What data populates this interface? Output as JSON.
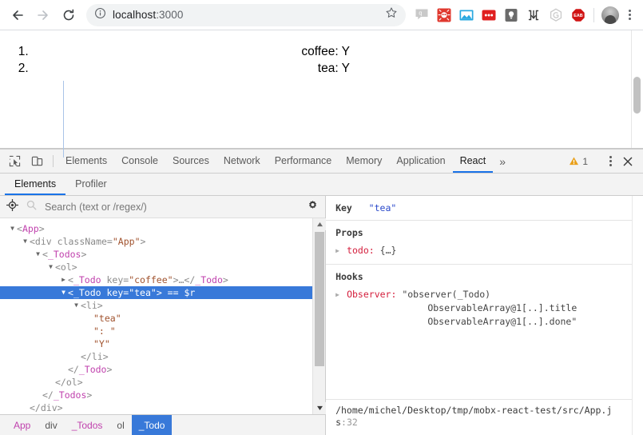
{
  "browser": {
    "back_label": "Back",
    "forward_label": "Forward",
    "reload_label": "Reload",
    "url_host": "localhost",
    "url_port": ":3000",
    "bookmark_label": "Bookmark this page",
    "menu_label": "Customize and control Chrome",
    "extensions": [
      {
        "name": "speech-bubble-extension-icon",
        "color": "#bfbfbf",
        "glyph": "q"
      },
      {
        "name": "red-spider-extension-icon",
        "color": "#e0392f",
        "glyph": ""
      },
      {
        "name": "blue-window-extension-icon",
        "color": "#2196f3",
        "glyph": ""
      },
      {
        "name": "red-dots-extension-icon",
        "color": "#e02020",
        "glyph": "•••"
      },
      {
        "name": "dark-bulb-extension-icon",
        "color": "#5a5a5a",
        "glyph": ""
      },
      {
        "name": "bracket-extension-icon",
        "color": "#ffffff",
        "glyph": "]v["
      },
      {
        "name": "gray-hex-extension-icon",
        "color": "#d8d8d8",
        "glyph": ""
      },
      {
        "name": "ead-stop-extension-icon",
        "color": "#d01414",
        "glyph": "EAB"
      }
    ]
  },
  "page": {
    "todos": [
      {
        "title": "coffee",
        "separator": ": ",
        "done": "Y",
        "text": "coffee: Y"
      },
      {
        "title": "tea",
        "separator": ": ",
        "done": "Y",
        "text": "tea: Y"
      }
    ]
  },
  "devtools": {
    "inspect_label": "Inspect element",
    "device_label": "Toggle device toolbar",
    "tabs": [
      {
        "label": "Elements",
        "active": false
      },
      {
        "label": "Console",
        "active": false
      },
      {
        "label": "Sources",
        "active": false
      },
      {
        "label": "Network",
        "active": false
      },
      {
        "label": "Performance",
        "active": false
      },
      {
        "label": "Memory",
        "active": false
      },
      {
        "label": "Application",
        "active": false
      },
      {
        "label": "React",
        "active": true
      }
    ],
    "more_tabs_glyph": "»",
    "warning_count": "1",
    "kebab_label": "More options",
    "close_label": "Close DevTools"
  },
  "react": {
    "subtabs": [
      {
        "label": "Elements",
        "active": true
      },
      {
        "label": "Profiler",
        "active": false
      }
    ],
    "search_placeholder": "Search (text or /regex/)",
    "search_value": "",
    "settings_label": "View settings",
    "select_element_label": "Select an element in the page to inspect it",
    "tree": [
      {
        "depth": 0,
        "arrow": "▼",
        "parts": [
          {
            "t": "tag-gray",
            "v": "<"
          },
          {
            "t": "comp-name",
            "v": "App"
          },
          {
            "t": "tag-gray",
            "v": ">"
          }
        ],
        "selected": false
      },
      {
        "depth": 1,
        "arrow": "▼",
        "parts": [
          {
            "t": "tag-gray",
            "v": "<div "
          },
          {
            "t": "attr-name",
            "v": "className="
          },
          {
            "t": "attr-val",
            "v": "\"App\""
          },
          {
            "t": "tag-gray",
            "v": ">"
          }
        ],
        "selected": false
      },
      {
        "depth": 2,
        "arrow": "▼",
        "parts": [
          {
            "t": "tag-gray",
            "v": "<"
          },
          {
            "t": "comp-name",
            "v": "_Todos"
          },
          {
            "t": "tag-gray",
            "v": ">"
          }
        ],
        "selected": false
      },
      {
        "depth": 3,
        "arrow": "▼",
        "parts": [
          {
            "t": "tag-gray",
            "v": "<ol>"
          }
        ],
        "selected": false
      },
      {
        "depth": 4,
        "arrow": "▶",
        "parts": [
          {
            "t": "tag-gray",
            "v": "<"
          },
          {
            "t": "comp-name",
            "v": "_Todo"
          },
          {
            "t": "attr-name",
            "v": " key="
          },
          {
            "t": "attr-val",
            "v": "\"coffee\""
          },
          {
            "t": "tag-gray",
            "v": ">…</"
          },
          {
            "t": "comp-name",
            "v": "_Todo"
          },
          {
            "t": "tag-gray",
            "v": ">"
          }
        ],
        "selected": false
      },
      {
        "depth": 4,
        "arrow": "▼",
        "parts": [
          {
            "t": "tag-gray",
            "v": "<"
          },
          {
            "t": "comp-name",
            "v": "_Todo"
          },
          {
            "t": "attr-name",
            "v": " key="
          },
          {
            "t": "attr-val",
            "v": "\"tea\""
          },
          {
            "t": "tag-gray",
            "v": ">"
          },
          {
            "t": "dollar-r",
            "v": " == $r"
          }
        ],
        "selected": true
      },
      {
        "depth": 5,
        "arrow": "▼",
        "parts": [
          {
            "t": "tag-gray",
            "v": "<li>"
          }
        ],
        "selected": false
      },
      {
        "depth": 6,
        "arrow": "",
        "parts": [
          {
            "t": "str-val",
            "v": "\"tea\""
          }
        ],
        "selected": false
      },
      {
        "depth": 6,
        "arrow": "",
        "parts": [
          {
            "t": "str-val",
            "v": "\": \""
          }
        ],
        "selected": false
      },
      {
        "depth": 6,
        "arrow": "",
        "parts": [
          {
            "t": "str-val",
            "v": "\"Y\""
          }
        ],
        "selected": false
      },
      {
        "depth": 5,
        "arrow": "",
        "parts": [
          {
            "t": "tag-gray",
            "v": "</li>"
          }
        ],
        "selected": false
      },
      {
        "depth": 4,
        "arrow": "",
        "parts": [
          {
            "t": "tag-gray",
            "v": "</"
          },
          {
            "t": "comp-name",
            "v": "_Todo"
          },
          {
            "t": "tag-gray",
            "v": ">"
          }
        ],
        "selected": false
      },
      {
        "depth": 3,
        "arrow": "",
        "parts": [
          {
            "t": "tag-gray",
            "v": "</ol>"
          }
        ],
        "selected": false
      },
      {
        "depth": 2,
        "arrow": "",
        "parts": [
          {
            "t": "tag-gray",
            "v": "</"
          },
          {
            "t": "comp-name",
            "v": "_Todos"
          },
          {
            "t": "tag-gray",
            "v": ">"
          }
        ],
        "selected": false
      },
      {
        "depth": 1,
        "arrow": "",
        "parts": [
          {
            "t": "tag-gray",
            "v": "</div>"
          }
        ],
        "selected": false
      }
    ],
    "breadcrumb": [
      {
        "label": "App",
        "kind": "comp",
        "selected": false
      },
      {
        "label": "div",
        "kind": "host",
        "selected": false
      },
      {
        "label": "_Todos",
        "kind": "comp",
        "selected": false
      },
      {
        "label": "ol",
        "kind": "host",
        "selected": false
      },
      {
        "label": "_Todo",
        "kind": "comp",
        "selected": true
      }
    ],
    "detail": {
      "key_label": "Key",
      "key_value": "\"tea\"",
      "props_title": "Props",
      "props": [
        {
          "name": "todo:",
          "value": "{…}",
          "expandable": true
        }
      ],
      "hooks_title": "Hooks",
      "hooks": [
        {
          "name": "Observer:",
          "value_line1": "\"observer(_Todo)",
          "value_line2": "ObservableArray@1[..].title",
          "value_line3": "ObservableArray@1[..].done\"",
          "expandable": true
        }
      ],
      "source_path": "/home/michel/Desktop/tmp/mobx-react-test/src/App.js",
      "source_line": ":32"
    }
  }
}
